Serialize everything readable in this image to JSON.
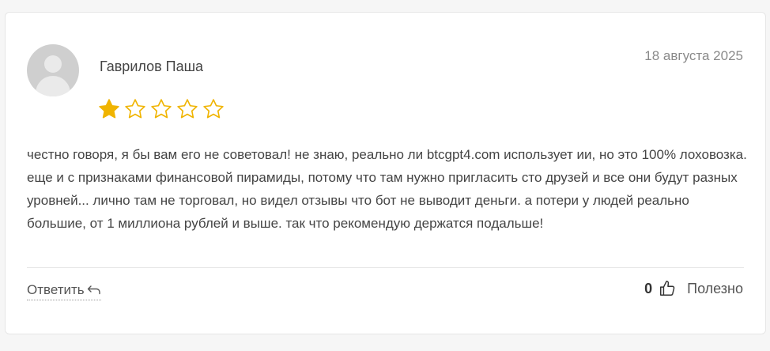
{
  "review": {
    "author": "Гаврилов Паша",
    "date": "18 августа 2025",
    "rating": 1,
    "max_rating": 5,
    "text": "честно говоря, я бы вам его не советовал! не знаю, реально ли btcgpt4.com использует ии, но это 100% лоховозка. еще и с признаками финансовой пирамиды, потому что там нужно пригласить сто друзей и все они будут разных уровней... лично там не торговал, но видел отзывы что бот не выводит деньги. а потери у людей реально большие, от 1 миллиона рублей и выше. так что рекомендую держатся подальше!"
  },
  "actions": {
    "reply_label": "Ответить",
    "helpful_count": "0",
    "helpful_label": "Полезно"
  },
  "icons": {
    "avatar": "user-placeholder-icon",
    "star_filled": "star-filled-icon",
    "star_empty": "star-outline-icon",
    "reply": "reply-arrow-icon",
    "thumb": "thumbs-up-icon"
  },
  "colors": {
    "star": "#f0b400",
    "text": "#444444",
    "date": "#8a8a8a"
  }
}
